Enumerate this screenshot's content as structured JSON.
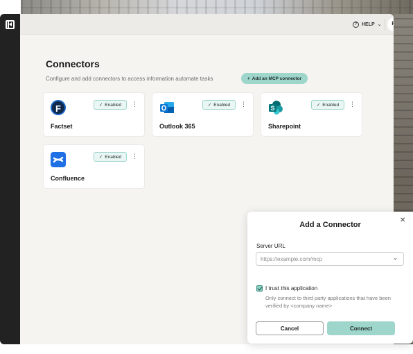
{
  "topbar": {
    "help_label": "HELP",
    "avatar_initials": "PS"
  },
  "page": {
    "title": "Connectors",
    "subtitle": "Configure and add connectors to access information automate tasks",
    "add_button_label": "Add an MCP connector"
  },
  "connectors": [
    {
      "name": "Factset",
      "status": "Enabled",
      "icon": "factset-icon"
    },
    {
      "name": "Outlook 365",
      "status": "Enabled",
      "icon": "outlook-icon"
    },
    {
      "name": "Sharepoint",
      "status": "Enabled",
      "icon": "sharepoint-icon"
    },
    {
      "name": "Confluence",
      "status": "Enabled",
      "icon": "confluence-icon"
    }
  ],
  "modal": {
    "title": "Add a Connector",
    "server_url_label": "Server URL",
    "server_url_placeholder": "https://example.com/mcp",
    "server_url_value": "",
    "trust_checked": true,
    "trust_label": "I trust this application",
    "trust_help": "Only connect to third party applications that have been verified by <company name>",
    "cancel_label": "Cancel",
    "connect_label": "Connect"
  },
  "colors": {
    "accent": "#9ed6cc",
    "sidebar": "#222222",
    "background": "#f5f4f1"
  }
}
